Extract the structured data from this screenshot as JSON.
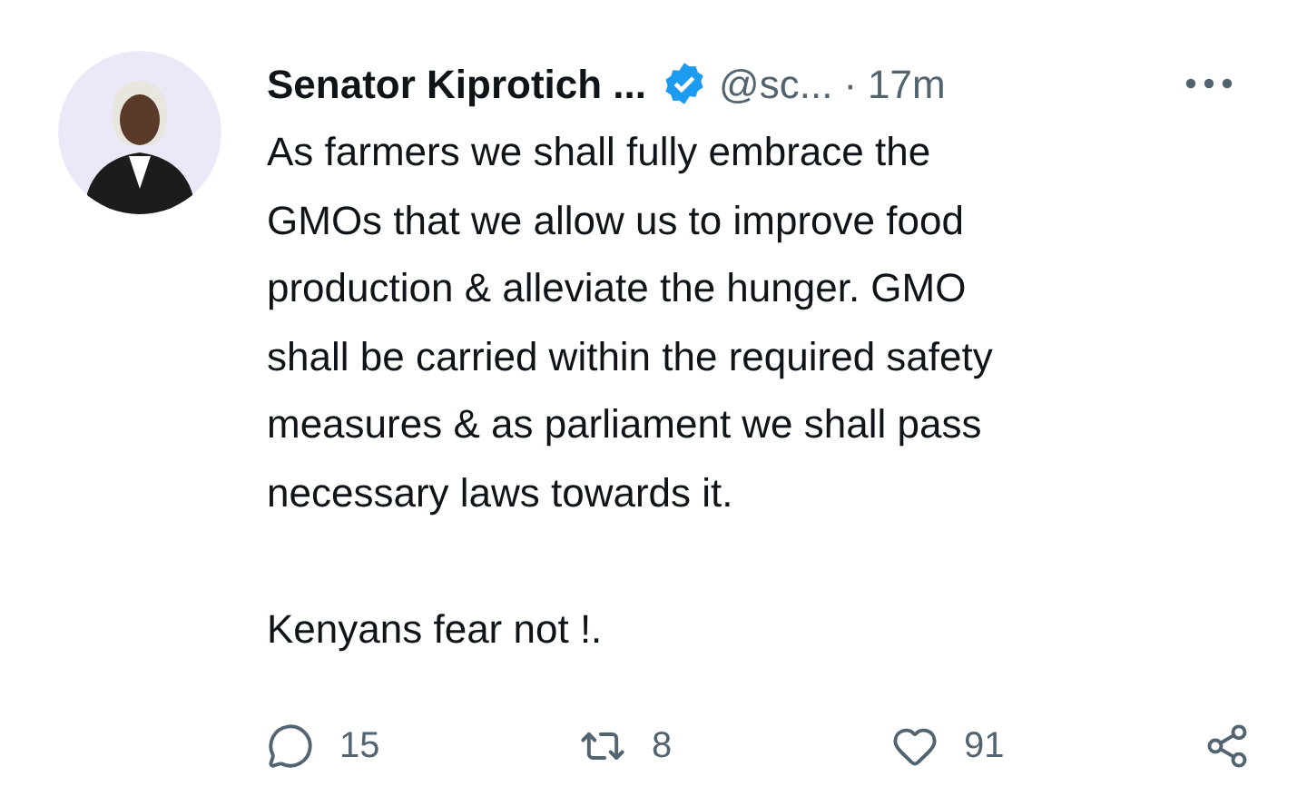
{
  "author": {
    "name": "Senator Kiprotich ...",
    "verified": true,
    "handle": "@sc...",
    "separator": "·",
    "time": "17m"
  },
  "paragraphs": [
    {
      "lines": [
        "As farmers we shall fully embrace the",
        "GMOs that we allow us to improve food",
        "production & alleviate the hunger. GMO",
        "shall be carried within the required safety",
        "measures & as parliament we shall pass",
        "necessary laws towards it."
      ]
    },
    {
      "lines": [
        "Kenyans fear not !."
      ]
    }
  ],
  "actions": [
    {
      "kind": "reply",
      "count": "15"
    },
    {
      "kind": "retweet",
      "count": "8"
    },
    {
      "kind": "like",
      "count": "91"
    },
    {
      "kind": "share"
    }
  ]
}
